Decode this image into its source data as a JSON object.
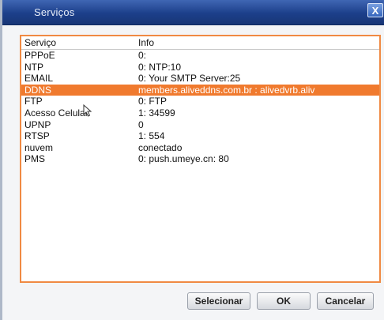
{
  "window": {
    "title": "Serviços",
    "close_glyph": "X"
  },
  "table": {
    "columns": [
      "Serviço",
      "Info"
    ],
    "rows": [
      {
        "service": "PPPoE",
        "info": "0:"
      },
      {
        "service": "NTP",
        "info": "0: NTP:10"
      },
      {
        "service": "EMAIL",
        "info": "0: Your SMTP Server:25"
      },
      {
        "service": "DDNS",
        "info": "members.aliveddns.com.br : alivedvrb.aliv",
        "selected": true
      },
      {
        "service": "FTP",
        "info": "0: FTP"
      },
      {
        "service": "Acesso Celular",
        "info": "1: 34599"
      },
      {
        "service": "UPNP",
        "info": "0"
      },
      {
        "service": "RTSP",
        "info": "1: 554"
      },
      {
        "service": "nuvem",
        "info": "conectado"
      },
      {
        "service": "PMS",
        "info": "0: push.umeye.cn: 80"
      }
    ]
  },
  "buttons": {
    "select": "Selecionar",
    "ok": "OK",
    "cancel": "Cancelar"
  },
  "colors": {
    "title_bar": "#1c3f8a",
    "selection": "#f07a2e",
    "panel_border": "#f08a43"
  },
  "icons": {
    "close": "close-icon",
    "cursor": "mouse-pointer-icon"
  }
}
